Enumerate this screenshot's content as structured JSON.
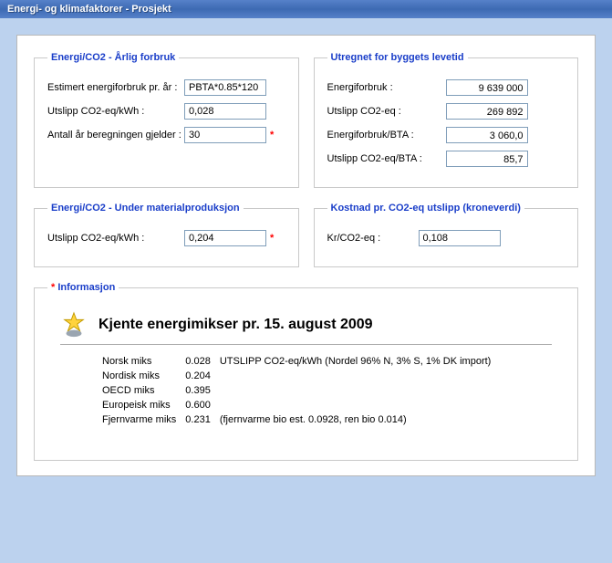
{
  "window": {
    "title": "Energi- og klimafaktorer - Prosjekt"
  },
  "sections": {
    "annual": {
      "legend": "Energi/CO2 - Årlig forbruk",
      "estimated_label": "Estimert energiforbruk pr. år :",
      "estimated_value": "PBTA*0.85*120",
      "utslipp_label": "Utslipp CO2-eq/kWh :",
      "utslipp_value": "0,028",
      "years_label": "Antall år beregningen gjelder :",
      "years_value": "30"
    },
    "lifetime": {
      "legend": "Utregnet for byggets levetid",
      "energiforbruk_label": "Energiforbruk :",
      "energiforbruk_value": "9 639 000",
      "utslipp_label": "Utslipp CO2-eq :",
      "utslipp_value": "269 892",
      "eforbruk_bta_label": "Energiforbruk/BTA :",
      "eforbruk_bta_value": "3 060,0",
      "utslipp_bta_label": "Utslipp CO2-eq/BTA :",
      "utslipp_bta_value": "85,7"
    },
    "material": {
      "legend": "Energi/CO2 - Under materialproduksjon",
      "utslipp_label": "Utslipp CO2-eq/kWh :",
      "utslipp_value": "0,204"
    },
    "cost": {
      "legend": "Kostnad pr. CO2-eq utslipp (kroneverdi)",
      "kr_label": "Kr/CO2-eq :",
      "kr_value": "0,108"
    },
    "info": {
      "legend": "Informasjon",
      "title": "Kjente energimikser pr. 15. august 2009",
      "rows": [
        {
          "name": "Norsk miks",
          "value": "0.028",
          "note": "UTSLIPP CO2-eq/kWh (Nordel 96% N, 3% S, 1% DK import)"
        },
        {
          "name": "Nordisk miks",
          "value": "0.204",
          "note": ""
        },
        {
          "name": "OECD miks",
          "value": "0.395",
          "note": ""
        },
        {
          "name": "Europeisk miks",
          "value": "0.600",
          "note": ""
        },
        {
          "name": "Fjernvarme miks",
          "value": "0.231",
          "note": "(fjernvarme bio est. 0.0928, ren bio 0.014)"
        }
      ]
    }
  }
}
